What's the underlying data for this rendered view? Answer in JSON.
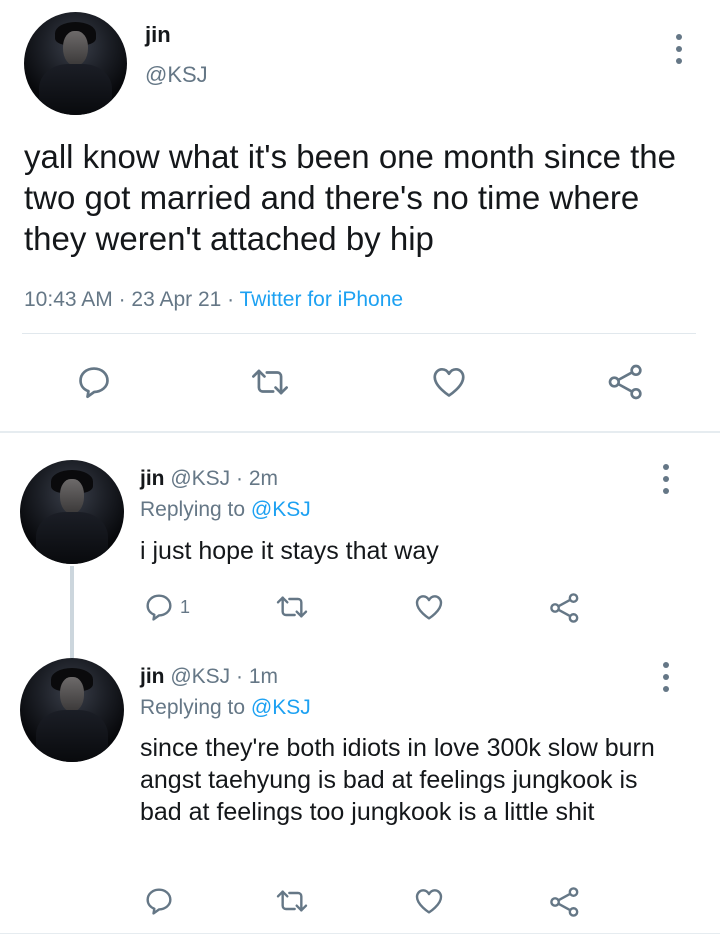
{
  "main_tweet": {
    "name": "jin",
    "handle": "@KSJ",
    "text": "yall know what it's been one month since the two got married and there's no time where they weren't attached by hip",
    "time": "10:43 AM",
    "date": "23 Apr 21",
    "separator": "·",
    "source": "Twitter for iPhone",
    "actions": [
      "reply-icon",
      "retweet-icon",
      "like-icon",
      "share-icon"
    ]
  },
  "replies": [
    {
      "name": "jin",
      "handle": "@KSJ",
      "time": "2m",
      "separator": "·",
      "replying_label": "Replying to",
      "replying_handle": "@KSJ",
      "text": "i just hope it stays that way",
      "reply_count": "1"
    },
    {
      "name": "jin",
      "handle": "@KSJ",
      "time": "1m",
      "separator": "·",
      "replying_label": "Replying to",
      "replying_handle": "@KSJ",
      "text": "since they're both idiots in love 300k slow burn angst taehyung is bad at feelings jungkook is bad at feelings too jungkook is a little shit",
      "reply_count": ""
    }
  ],
  "colors": {
    "text": "#14171a",
    "muted": "#657786",
    "link": "#1da1f2",
    "divider": "#e1e8ed",
    "thread_line": "#ccd6dd"
  }
}
